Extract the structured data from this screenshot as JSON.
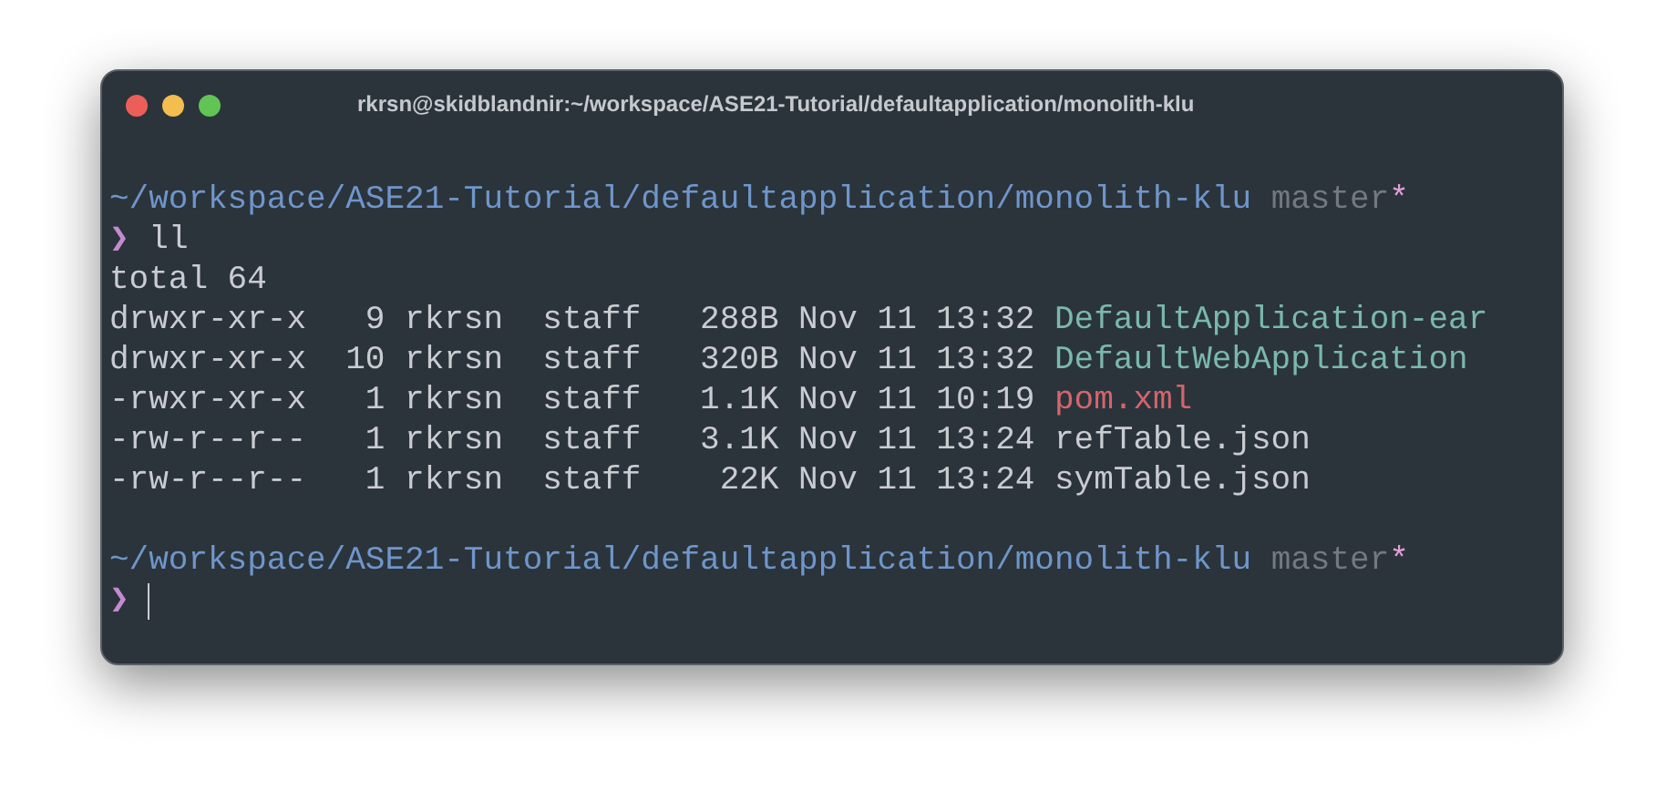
{
  "window": {
    "title": "rkrsn@skidblandnir:~/workspace/ASE21-Tutorial/defaultapplication/monolith-klu",
    "controls": [
      {
        "color": "#ec5f59"
      },
      {
        "color": "#f4bd4f"
      },
      {
        "color": "#61c454"
      }
    ]
  },
  "lines": [
    {
      "kind": "blank"
    },
    {
      "kind": "path",
      "path": "~/workspace/ASE21-Tutorial/defaultapplication/monolith-klu",
      "branch": "master",
      "dirty": "*"
    },
    {
      "kind": "command",
      "prompt": "❯",
      "text": "ll",
      "cursor": false
    },
    {
      "kind": "text",
      "text": "total 64"
    },
    {
      "kind": "entry",
      "info": "drwxr-xr-x   9 rkrsn  staff   288B Nov 11 13:32",
      "name": "DefaultApplication-ear",
      "color": "#7ab8ad"
    },
    {
      "kind": "entry",
      "info": "drwxr-xr-x  10 rkrsn  staff   320B Nov 11 13:32",
      "name": "DefaultWebApplication",
      "color": "#7ab8ad"
    },
    {
      "kind": "entry",
      "info": "-rwxr-xr-x   1 rkrsn  staff   1.1K Nov 11 10:19",
      "name": "pom.xml",
      "color": "#d3656d"
    },
    {
      "kind": "entry",
      "info": "-rw-r--r--   1 rkrsn  staff   3.1K Nov 11 13:24",
      "name": "refTable.json",
      "color": "#c9ccd1"
    },
    {
      "kind": "entry",
      "info": "-rw-r--r--   1 rkrsn  staff    22K Nov 11 13:24",
      "name": "symTable.json",
      "color": "#c9ccd1"
    },
    {
      "kind": "blank"
    },
    {
      "kind": "path",
      "path": "~/workspace/ASE21-Tutorial/defaultapplication/monolith-klu",
      "branch": "master",
      "dirty": "*"
    },
    {
      "kind": "command",
      "prompt": "❯",
      "cursor": true
    }
  ]
}
